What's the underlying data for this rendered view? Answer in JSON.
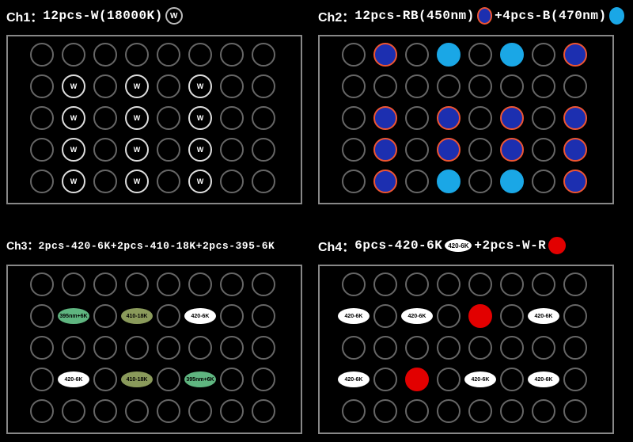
{
  "ch1": {
    "label_prefix": "Ch1：",
    "label_spec": "12pcs-W(18000K)",
    "legend_icons": [
      {
        "type": "W",
        "text": "W"
      }
    ],
    "grid": [
      [
        "",
        "",
        "",
        "",
        "",
        "",
        "",
        ""
      ],
      [
        "",
        "W",
        "",
        "W",
        "",
        "W",
        "",
        ""
      ],
      [
        "",
        "W",
        "",
        "W",
        "",
        "W",
        "",
        ""
      ],
      [
        "",
        "W",
        "",
        "W",
        "",
        "W",
        "",
        ""
      ],
      [
        "",
        "W",
        "",
        "W",
        "",
        "W",
        "",
        ""
      ]
    ]
  },
  "ch2": {
    "label_prefix": "Ch2：",
    "label_spec_a": "12pcs-RB(450nm)",
    "label_spec_b": "+4pcs-B(470nm)",
    "legend_icons": [
      {
        "type": "RB"
      },
      {
        "type": "B"
      }
    ],
    "grid": [
      [
        "",
        "RB",
        "",
        "B",
        "",
        "B",
        "",
        "RB"
      ],
      [
        "",
        "",
        "",
        "",
        "",
        "",
        "",
        ""
      ],
      [
        "",
        "RB",
        "",
        "RB",
        "",
        "RB",
        "",
        "RB"
      ],
      [
        "",
        "RB",
        "",
        "RB",
        "",
        "RB",
        "",
        "RB"
      ],
      [
        "",
        "RB",
        "",
        "B",
        "",
        "B",
        "",
        "RB"
      ]
    ]
  },
  "ch3": {
    "label_prefix": "Ch3：",
    "label_spec": "2pcs-420-6K+2pcs-410-18K+2pcs-395-6K",
    "legend_icons": [],
    "grid_ovals": {
      "rows": 5,
      "cols": 8,
      "cells": {
        "1,1": {
          "text": "395nm+6K",
          "class": "green"
        },
        "1,3": {
          "text": "410-18K",
          "class": "olive"
        },
        "1,5": {
          "text": "420-6K",
          "class": "white"
        },
        "3,1": {
          "text": "420-6K",
          "class": "white"
        },
        "3,3": {
          "text": "410-18K",
          "class": "olive"
        },
        "3,5": {
          "text": "395nm+6K",
          "class": "green"
        }
      }
    }
  },
  "ch4": {
    "label_prefix": "Ch4：",
    "label_spec_a": "6pcs-420-6K",
    "label_spec_b": "+2pcs-W-R",
    "legend_oval": "420-6K",
    "grid_mixed": {
      "rows": 5,
      "cols": 8,
      "cells": {
        "1,0": {
          "kind": "oval",
          "text": "420-6K",
          "class": "white"
        },
        "1,2": {
          "kind": "oval",
          "text": "420-6K",
          "class": "white"
        },
        "1,4": {
          "kind": "circle",
          "type": "RED"
        },
        "1,6": {
          "kind": "oval",
          "text": "420-6K",
          "class": "white"
        },
        "3,0": {
          "kind": "oval",
          "text": "420-6K",
          "class": "white"
        },
        "3,2": {
          "kind": "circle",
          "type": "RED"
        },
        "3,4": {
          "kind": "oval",
          "text": "420-6K",
          "class": "white"
        },
        "3,6": {
          "kind": "oval",
          "text": "420-6K",
          "class": "white"
        }
      }
    }
  }
}
